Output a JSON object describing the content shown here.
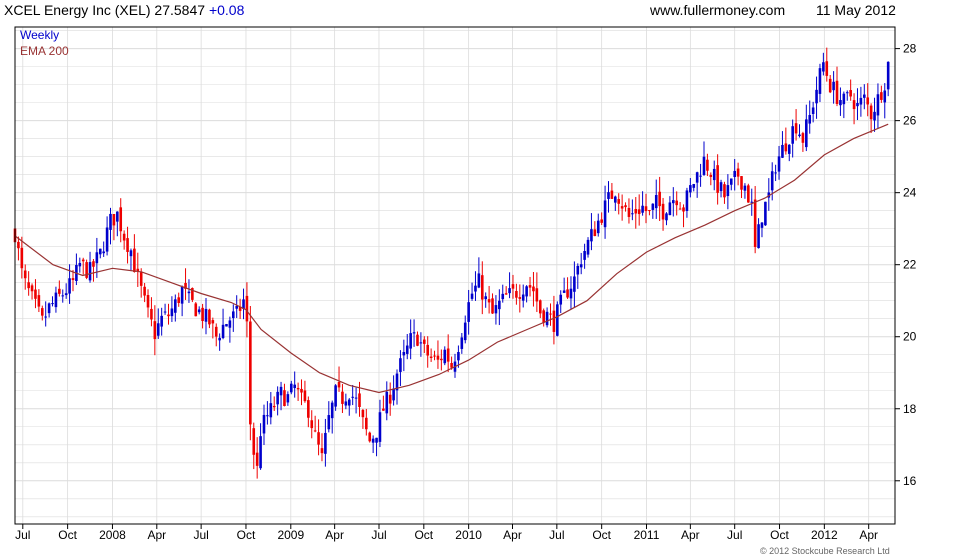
{
  "header": {
    "title": "XCEL Energy Inc (XEL) 27.5847",
    "change": "+0.08",
    "site": "www.fullermoney.com",
    "date": "11 May 2012"
  },
  "copyright": "© 2012 Stockcube Research Ltd",
  "colors": {
    "up": "#0000cc",
    "down": "#ee0000",
    "ema": "#993333",
    "grid": "#dcdcdc",
    "axis": "#000000",
    "change": "#0000cc"
  },
  "chart_data": {
    "type": "candlestick",
    "title": "XCEL Energy Inc (XEL) 27.5847",
    "legend": [
      "Weekly",
      "EMA 200"
    ],
    "legend_position": "top-left",
    "ylim": [
      14.8,
      28.6
    ],
    "ytick_values": [
      16,
      18,
      20,
      22,
      24,
      26,
      28
    ],
    "grid": true,
    "x_range": [
      "2007-06-15",
      "2012-05-25"
    ],
    "x_ticks": [
      {
        "label": "Jul",
        "date": "2007-07-01"
      },
      {
        "label": "Oct",
        "date": "2007-10-01"
      },
      {
        "label": "2008",
        "date": "2008-01-01"
      },
      {
        "label": "Apr",
        "date": "2008-04-01"
      },
      {
        "label": "Jul",
        "date": "2008-07-01"
      },
      {
        "label": "Oct",
        "date": "2008-10-01"
      },
      {
        "label": "2009",
        "date": "2009-01-01"
      },
      {
        "label": "Apr",
        "date": "2009-04-01"
      },
      {
        "label": "Jul",
        "date": "2009-07-01"
      },
      {
        "label": "Oct",
        "date": "2009-10-01"
      },
      {
        "label": "2010",
        "date": "2010-01-01"
      },
      {
        "label": "Apr",
        "date": "2010-04-01"
      },
      {
        "label": "Jul",
        "date": "2010-07-01"
      },
      {
        "label": "Oct",
        "date": "2010-10-01"
      },
      {
        "label": "2011",
        "date": "2011-01-01"
      },
      {
        "label": "Apr",
        "date": "2011-04-01"
      },
      {
        "label": "Jul",
        "date": "2011-07-01"
      },
      {
        "label": "Oct",
        "date": "2011-10-01"
      },
      {
        "label": "2012",
        "date": "2012-01-01"
      },
      {
        "label": "Apr",
        "date": "2012-04-01"
      }
    ],
    "weekly_close_path": [
      [
        "2007-06-15",
        22.9
      ],
      [
        "2007-07-01",
        21.6
      ],
      [
        "2007-08-10",
        20.4
      ],
      [
        "2007-08-24",
        20.8
      ],
      [
        "2007-09-21",
        21.2
      ],
      [
        "2007-10-12",
        21.5
      ],
      [
        "2007-10-26",
        22.0
      ],
      [
        "2007-11-16",
        21.8
      ],
      [
        "2007-12-07",
        22.3
      ],
      [
        "2007-12-28",
        23.2
      ],
      [
        "2008-01-11",
        23.4
      ],
      [
        "2008-01-25",
        22.8
      ],
      [
        "2008-02-08",
        22.4
      ],
      [
        "2008-02-22",
        21.6
      ],
      [
        "2008-03-14",
        20.6
      ],
      [
        "2008-03-28",
        20.1
      ],
      [
        "2008-04-11",
        20.5
      ],
      [
        "2008-04-25",
        20.6
      ],
      [
        "2008-05-09",
        20.9
      ],
      [
        "2008-05-23",
        21.3
      ],
      [
        "2008-06-06",
        21.0
      ],
      [
        "2008-06-20",
        20.8
      ],
      [
        "2008-07-04",
        20.6
      ],
      [
        "2008-07-18",
        20.4
      ],
      [
        "2008-08-01",
        20.0
      ],
      [
        "2008-08-15",
        20.3
      ],
      [
        "2008-08-29",
        20.5
      ],
      [
        "2008-09-12",
        20.6
      ],
      [
        "2008-09-26",
        21.0
      ],
      [
        "2008-10-03",
        20.3
      ],
      [
        "2008-10-10",
        17.6
      ],
      [
        "2008-10-17",
        16.8
      ],
      [
        "2008-10-24",
        16.3
      ],
      [
        "2008-10-31",
        17.4
      ],
      [
        "2008-11-14",
        17.8
      ],
      [
        "2008-11-28",
        18.1
      ],
      [
        "2008-12-12",
        18.4
      ],
      [
        "2008-12-26",
        18.3
      ],
      [
        "2009-01-09",
        18.6
      ],
      [
        "2009-01-23",
        18.2
      ],
      [
        "2009-02-06",
        18.0
      ],
      [
        "2009-02-20",
        17.2
      ],
      [
        "2009-03-06",
        16.6
      ],
      [
        "2009-03-20",
        17.7
      ],
      [
        "2009-04-03",
        18.4
      ],
      [
        "2009-04-17",
        18.3
      ],
      [
        "2009-05-01",
        18.5
      ],
      [
        "2009-05-15",
        18.2
      ],
      [
        "2009-05-29",
        17.6
      ],
      [
        "2009-06-12",
        17.1
      ],
      [
        "2009-06-26",
        17.4
      ],
      [
        "2009-07-10",
        18.0
      ],
      [
        "2009-07-24",
        18.4
      ],
      [
        "2009-08-07",
        19.0
      ],
      [
        "2009-08-21",
        19.4
      ],
      [
        "2009-09-04",
        19.9
      ],
      [
        "2009-09-18",
        20.0
      ],
      [
        "2009-10-02",
        19.6
      ],
      [
        "2009-10-16",
        19.4
      ],
      [
        "2009-10-30",
        19.3
      ],
      [
        "2009-11-13",
        19.6
      ],
      [
        "2009-11-27",
        19.2
      ],
      [
        "2009-12-11",
        19.8
      ],
      [
        "2009-12-25",
        20.6
      ],
      [
        "2010-01-08",
        21.2
      ],
      [
        "2010-01-22",
        21.5
      ],
      [
        "2010-02-05",
        21.0
      ],
      [
        "2010-02-19",
        20.6
      ],
      [
        "2010-03-05",
        20.9
      ],
      [
        "2010-03-19",
        21.1
      ],
      [
        "2010-04-02",
        21.2
      ],
      [
        "2010-04-16",
        21.3
      ],
      [
        "2010-04-30",
        21.5
      ],
      [
        "2010-05-14",
        21.3
      ],
      [
        "2010-05-28",
        20.7
      ],
      [
        "2010-06-11",
        20.6
      ],
      [
        "2010-06-25",
        20.4
      ],
      [
        "2010-07-09",
        20.9
      ],
      [
        "2010-07-23",
        21.3
      ],
      [
        "2010-08-06",
        21.6
      ],
      [
        "2010-08-20",
        22.2
      ],
      [
        "2010-09-03",
        22.6
      ],
      [
        "2010-09-17",
        23.0
      ],
      [
        "2010-10-01",
        23.4
      ],
      [
        "2010-10-15",
        23.8
      ],
      [
        "2010-10-29",
        24.1
      ],
      [
        "2010-11-12",
        23.7
      ],
      [
        "2010-11-26",
        23.3
      ],
      [
        "2010-12-10",
        23.5
      ],
      [
        "2010-12-24",
        23.6
      ],
      [
        "2011-01-07",
        23.4
      ],
      [
        "2011-01-21",
        23.7
      ],
      [
        "2011-02-04",
        23.5
      ],
      [
        "2011-02-18",
        23.8
      ],
      [
        "2011-03-04",
        23.9
      ],
      [
        "2011-03-18",
        23.6
      ],
      [
        "2011-04-01",
        24.1
      ],
      [
        "2011-04-15",
        24.5
      ],
      [
        "2011-04-29",
        24.9
      ],
      [
        "2011-05-13",
        24.6
      ],
      [
        "2011-05-27",
        24.2
      ],
      [
        "2011-06-10",
        23.9
      ],
      [
        "2011-06-24",
        24.2
      ],
      [
        "2011-07-08",
        24.5
      ],
      [
        "2011-07-22",
        24.2
      ],
      [
        "2011-08-05",
        23.6
      ],
      [
        "2011-08-12",
        22.4
      ],
      [
        "2011-08-26",
        23.4
      ],
      [
        "2011-09-09",
        23.9
      ],
      [
        "2011-09-23",
        24.8
      ],
      [
        "2011-10-07",
        25.2
      ],
      [
        "2011-10-21",
        25.6
      ],
      [
        "2011-11-04",
        25.9
      ],
      [
        "2011-11-18",
        25.5
      ],
      [
        "2011-12-02",
        26.1
      ],
      [
        "2011-12-16",
        26.9
      ],
      [
        "2011-12-30",
        27.6
      ],
      [
        "2012-01-13",
        27.0
      ],
      [
        "2012-01-27",
        26.7
      ],
      [
        "2012-02-10",
        26.5
      ],
      [
        "2012-02-24",
        26.7
      ],
      [
        "2012-03-09",
        26.4
      ],
      [
        "2012-03-23",
        26.6
      ],
      [
        "2012-04-06",
        26.2
      ],
      [
        "2012-04-20",
        26.6
      ],
      [
        "2012-05-04",
        27.1
      ],
      [
        "2012-05-11",
        27.58
      ]
    ],
    "ema200": [
      [
        "2007-06-15",
        22.8
      ],
      [
        "2007-09-01",
        22.0
      ],
      [
        "2007-11-01",
        21.7
      ],
      [
        "2008-01-01",
        21.9
      ],
      [
        "2008-03-01",
        21.8
      ],
      [
        "2008-05-01",
        21.5
      ],
      [
        "2008-07-01",
        21.2
      ],
      [
        "2008-09-01",
        20.95
      ],
      [
        "2008-10-01",
        20.75
      ],
      [
        "2008-11-01",
        20.2
      ],
      [
        "2009-01-01",
        19.55
      ],
      [
        "2009-03-01",
        19.0
      ],
      [
        "2009-05-01",
        18.65
      ],
      [
        "2009-07-01",
        18.45
      ],
      [
        "2009-09-01",
        18.65
      ],
      [
        "2009-11-01",
        18.95
      ],
      [
        "2010-01-01",
        19.35
      ],
      [
        "2010-03-01",
        19.85
      ],
      [
        "2010-05-01",
        20.2
      ],
      [
        "2010-07-01",
        20.55
      ],
      [
        "2010-09-01",
        21.0
      ],
      [
        "2010-11-01",
        21.75
      ],
      [
        "2011-01-01",
        22.35
      ],
      [
        "2011-03-01",
        22.75
      ],
      [
        "2011-05-01",
        23.1
      ],
      [
        "2011-07-01",
        23.5
      ],
      [
        "2011-09-01",
        23.85
      ],
      [
        "2011-11-01",
        24.35
      ],
      [
        "2012-01-01",
        25.05
      ],
      [
        "2012-03-01",
        25.5
      ],
      [
        "2012-05-11",
        25.9
      ]
    ]
  }
}
